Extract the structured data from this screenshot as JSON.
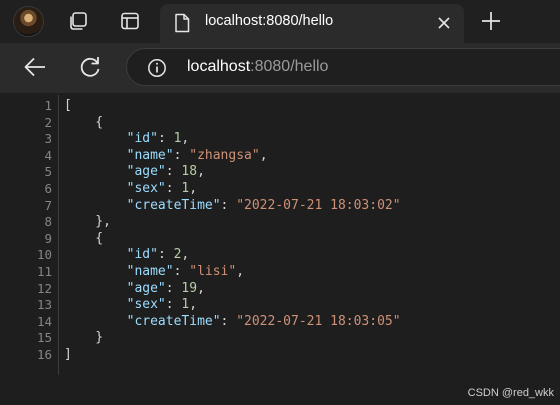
{
  "browser": {
    "tab_title": "localhost:8080/hello",
    "url_host": "localhost",
    "url_rest": ":8080/hello"
  },
  "code_lines": [
    {
      "num": "1",
      "parts": [
        {
          "t": "[",
          "c": "p"
        }
      ]
    },
    {
      "num": "2",
      "parts": [
        {
          "t": "    {",
          "c": "p"
        }
      ]
    },
    {
      "num": "3",
      "parts": [
        {
          "t": "        ",
          "c": "p"
        },
        {
          "t": "\"id\"",
          "c": "k"
        },
        {
          "t": ": ",
          "c": "p"
        },
        {
          "t": "1",
          "c": "n"
        },
        {
          "t": ",",
          "c": "p"
        }
      ]
    },
    {
      "num": "4",
      "parts": [
        {
          "t": "        ",
          "c": "p"
        },
        {
          "t": "\"name\"",
          "c": "k"
        },
        {
          "t": ": ",
          "c": "p"
        },
        {
          "t": "\"zhangsa\"",
          "c": "s"
        },
        {
          "t": ",",
          "c": "p"
        }
      ]
    },
    {
      "num": "5",
      "parts": [
        {
          "t": "        ",
          "c": "p"
        },
        {
          "t": "\"age\"",
          "c": "k"
        },
        {
          "t": ": ",
          "c": "p"
        },
        {
          "t": "18",
          "c": "n"
        },
        {
          "t": ",",
          "c": "p"
        }
      ]
    },
    {
      "num": "6",
      "parts": [
        {
          "t": "        ",
          "c": "p"
        },
        {
          "t": "\"sex\"",
          "c": "k"
        },
        {
          "t": ": ",
          "c": "p"
        },
        {
          "t": "1",
          "c": "n"
        },
        {
          "t": ",",
          "c": "p"
        }
      ]
    },
    {
      "num": "7",
      "parts": [
        {
          "t": "        ",
          "c": "p"
        },
        {
          "t": "\"createTime\"",
          "c": "k"
        },
        {
          "t": ": ",
          "c": "p"
        },
        {
          "t": "\"2022-07-21 18:03:02\"",
          "c": "s"
        }
      ]
    },
    {
      "num": "8",
      "parts": [
        {
          "t": "    },",
          "c": "p"
        }
      ]
    },
    {
      "num": "9",
      "parts": [
        {
          "t": "    {",
          "c": "p"
        }
      ]
    },
    {
      "num": "10",
      "parts": [
        {
          "t": "        ",
          "c": "p"
        },
        {
          "t": "\"id\"",
          "c": "k"
        },
        {
          "t": ": ",
          "c": "p"
        },
        {
          "t": "2",
          "c": "n"
        },
        {
          "t": ",",
          "c": "p"
        }
      ]
    },
    {
      "num": "11",
      "parts": [
        {
          "t": "        ",
          "c": "p"
        },
        {
          "t": "\"name\"",
          "c": "k"
        },
        {
          "t": ": ",
          "c": "p"
        },
        {
          "t": "\"lisi\"",
          "c": "s"
        },
        {
          "t": ",",
          "c": "p"
        }
      ]
    },
    {
      "num": "12",
      "parts": [
        {
          "t": "        ",
          "c": "p"
        },
        {
          "t": "\"age\"",
          "c": "k"
        },
        {
          "t": ": ",
          "c": "p"
        },
        {
          "t": "19",
          "c": "n"
        },
        {
          "t": ",",
          "c": "p"
        }
      ]
    },
    {
      "num": "13",
      "parts": [
        {
          "t": "        ",
          "c": "p"
        },
        {
          "t": "\"sex\"",
          "c": "k"
        },
        {
          "t": ": ",
          "c": "p"
        },
        {
          "t": "1",
          "c": "n"
        },
        {
          "t": ",",
          "c": "p"
        }
      ]
    },
    {
      "num": "14",
      "parts": [
        {
          "t": "        ",
          "c": "p"
        },
        {
          "t": "\"createTime\"",
          "c": "k"
        },
        {
          "t": ": ",
          "c": "p"
        },
        {
          "t": "\"2022-07-21 18:03:05\"",
          "c": "s"
        }
      ]
    },
    {
      "num": "15",
      "parts": [
        {
          "t": "    }",
          "c": "p"
        }
      ]
    },
    {
      "num": "16",
      "parts": [
        {
          "t": "]",
          "c": "p"
        }
      ]
    }
  ],
  "watermark": "CSDN @red_wkk",
  "icons": {
    "profile": "avatar",
    "collections": "collections-icon",
    "tab_actions": "tab-actions-icon",
    "page": "page-icon",
    "close": "close-icon",
    "new_tab": "plus-icon",
    "back": "back-arrow-icon",
    "refresh": "refresh-icon",
    "site_info": "info-icon"
  }
}
